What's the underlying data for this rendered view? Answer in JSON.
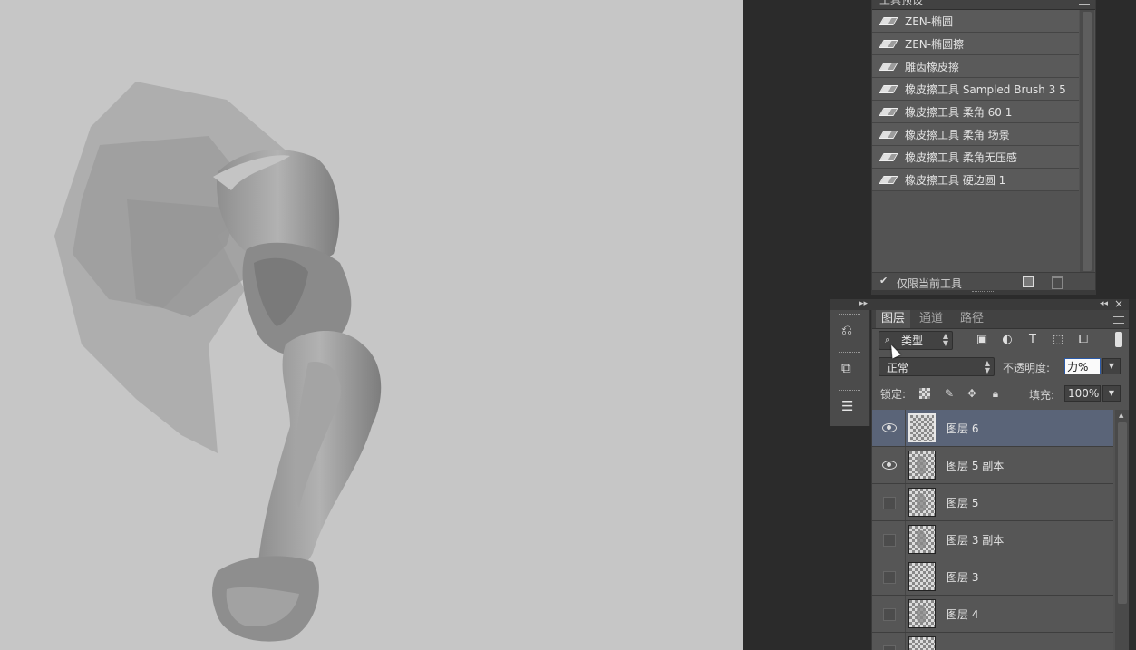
{
  "tool_presets": {
    "title": "工具预设",
    "items": [
      {
        "label": "ZEN-椭圆"
      },
      {
        "label": "ZEN-椭圆擦"
      },
      {
        "label": "雕齿橡皮擦"
      },
      {
        "label": "橡皮擦工具 Sampled Brush 3 5"
      },
      {
        "label": "橡皮擦工具 柔角 60 1"
      },
      {
        "label": "橡皮擦工具 柔角 场景"
      },
      {
        "label": "橡皮擦工具 柔角无压感"
      },
      {
        "label": "橡皮擦工具 硬边圆 1"
      }
    ],
    "current_tool_only_label": "仅限当前工具",
    "current_tool_only_checked": true
  },
  "layers_panel": {
    "tabs": [
      {
        "label": "图层",
        "active": true
      },
      {
        "label": "通道",
        "active": false
      },
      {
        "label": "路径",
        "active": false
      }
    ],
    "filter_kind": "类型",
    "blend_mode": "正常",
    "opacity_label": "不透明度:",
    "opacity_value": "力%",
    "lock_label": "锁定:",
    "fill_label": "填充:",
    "fill_value": "100%",
    "layers": [
      {
        "name": "图层 6",
        "visible": true,
        "selected": true,
        "has_art": false
      },
      {
        "name": "图层 5 副本",
        "visible": true,
        "selected": false,
        "has_art": true
      },
      {
        "name": "图层 5",
        "visible": false,
        "selected": false,
        "has_art": true
      },
      {
        "name": "图层 3 副本",
        "visible": false,
        "selected": false,
        "has_art": true
      },
      {
        "name": "图层 3",
        "visible": false,
        "selected": false,
        "has_art": false
      },
      {
        "name": "图层 4",
        "visible": false,
        "selected": false,
        "has_art": true
      },
      {
        "name": "",
        "visible": false,
        "selected": false,
        "has_art": false
      }
    ]
  },
  "dock_icons": [
    "history-icon",
    "3d-icon",
    "adjustments-icon"
  ],
  "colors": {
    "canvas": "#c6c6c6",
    "panel": "#535353",
    "selected_row": "#5a6478",
    "workspace": "#282828"
  }
}
